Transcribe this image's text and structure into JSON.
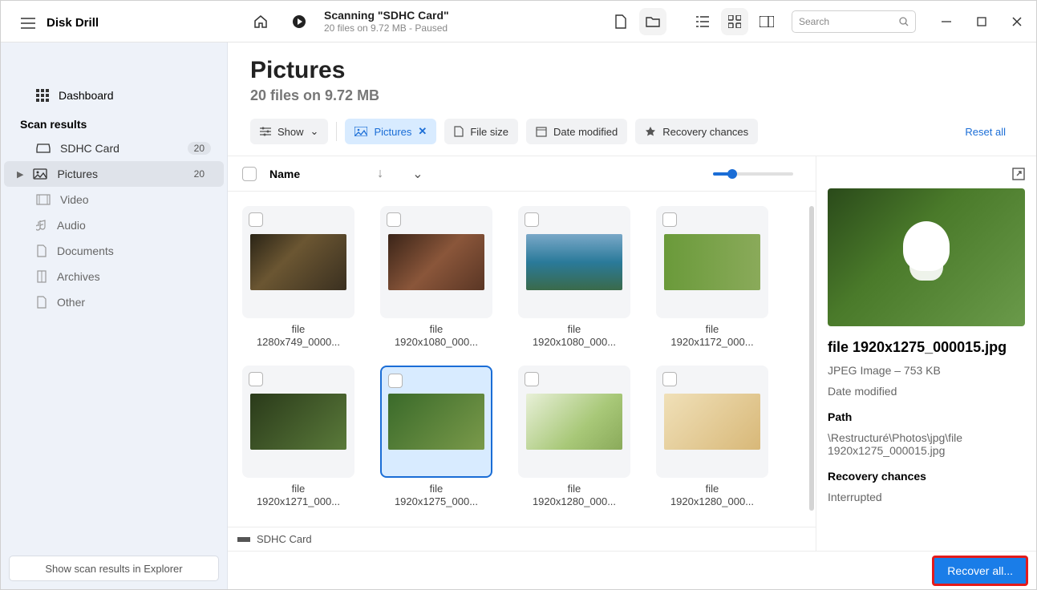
{
  "app": {
    "name": "Disk Drill"
  },
  "topbar": {
    "scan_title": "Scanning \"SDHC Card\"",
    "scan_sub": "20 files on 9.72 MB - Paused",
    "search_placeholder": "Search"
  },
  "sidebar": {
    "dashboard": "Dashboard",
    "section": "Scan results",
    "items": [
      {
        "label": "SDHC Card",
        "badge": "20"
      },
      {
        "label": "Pictures",
        "badge": "20"
      },
      {
        "label": "Video"
      },
      {
        "label": "Audio"
      },
      {
        "label": "Documents"
      },
      {
        "label": "Archives"
      },
      {
        "label": "Other"
      }
    ],
    "footer_btn": "Show scan results in Explorer"
  },
  "page": {
    "title": "Pictures",
    "subtitle": "20 files on 9.72 MB"
  },
  "filters": {
    "show": "Show",
    "pictures": "Pictures",
    "file_size": "File size",
    "date_modified": "Date modified",
    "recovery": "Recovery chances",
    "reset": "Reset all"
  },
  "grid_header": {
    "name": "Name"
  },
  "thumbs": [
    {
      "l1": "file",
      "l2": "1280x749_0000..."
    },
    {
      "l1": "file",
      "l2": "1920x1080_000..."
    },
    {
      "l1": "file",
      "l2": "1920x1080_000..."
    },
    {
      "l1": "file",
      "l2": "1920x1172_000..."
    },
    {
      "l1": "file",
      "l2": "1920x1271_000..."
    },
    {
      "l1": "file",
      "l2": "1920x1275_000..."
    },
    {
      "l1": "file",
      "l2": "1920x1280_000..."
    },
    {
      "l1": "file",
      "l2": "1920x1280_000..."
    }
  ],
  "preview": {
    "name": "file 1920x1275_000015.jpg",
    "meta": "JPEG Image – 753 KB",
    "date_label": "Date modified",
    "path_label": "Path",
    "path_value": "\\Restructuré\\Photos\\jpg\\file 1920x1275_000015.jpg",
    "rec_label": "Recovery chances",
    "rec_value": "Interrupted"
  },
  "status": {
    "device": "SDHC Card"
  },
  "bottom": {
    "recover": "Recover all..."
  }
}
